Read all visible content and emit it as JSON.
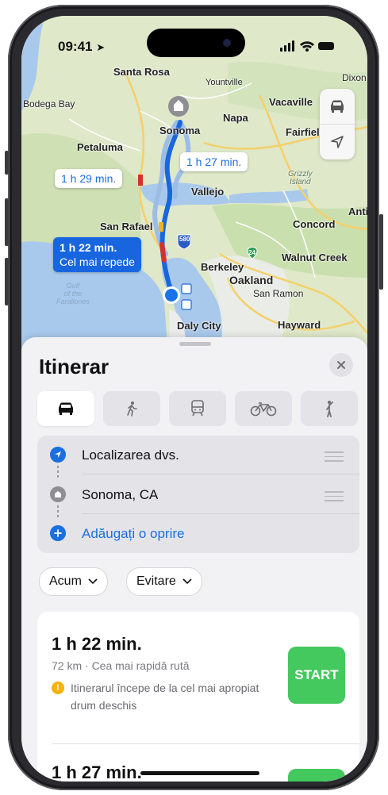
{
  "status_bar": {
    "time": "09:41"
  },
  "map": {
    "places": [
      "Santa Rosa",
      "Yountville",
      "Dixon",
      "Bodega Bay",
      "Vacaville",
      "Napa",
      "Fairfield",
      "Petaluma",
      "Sonoma",
      "Vallejo",
      "Antio",
      "San Rafael",
      "Concord",
      "Walnut Creek",
      "Berkeley",
      "Oakland",
      "San Ramon",
      "Hayward",
      "Daly City"
    ],
    "water_label": "Gulf\nof the\nFarallones",
    "park_label": "Grizzly\nIsland",
    "highway_shields": [
      "580",
      "24"
    ],
    "route_bubbles": [
      {
        "text": "1 h 29 min."
      },
      {
        "text": "1 h 27 min."
      }
    ],
    "primary_bubble": {
      "time": "1 h 22 min.",
      "label": "Cel mai repede"
    }
  },
  "map_controls": {
    "icons": [
      "car-icon",
      "location-arrow-icon"
    ]
  },
  "sheet": {
    "title": "Itinerar",
    "transport_modes": [
      "car-icon",
      "walk-icon",
      "transit-icon",
      "bicycle-icon",
      "rideshare-icon"
    ],
    "stops": [
      {
        "label": "Localizarea dvs.",
        "icon": "location-arrow-icon"
      },
      {
        "label": "Sonoma, CA",
        "icon": "landmark-icon"
      },
      {
        "label": "Adăugați o oprire",
        "icon": "plus-icon"
      }
    ],
    "filters": {
      "time": "Acum",
      "avoid": "Evitare"
    },
    "routes": [
      {
        "time": "1 h 22 min.",
        "meta": "72 km · Cea mai rapidă rută",
        "warning": "Itinerarul începe de la cel mai apropiat drum deschis",
        "start_label": "START"
      },
      {
        "time": "1 h 27 min."
      }
    ]
  },
  "colors": {
    "accent": "#1766e0",
    "start": "#43c95d",
    "warning": "#f5b30a"
  }
}
